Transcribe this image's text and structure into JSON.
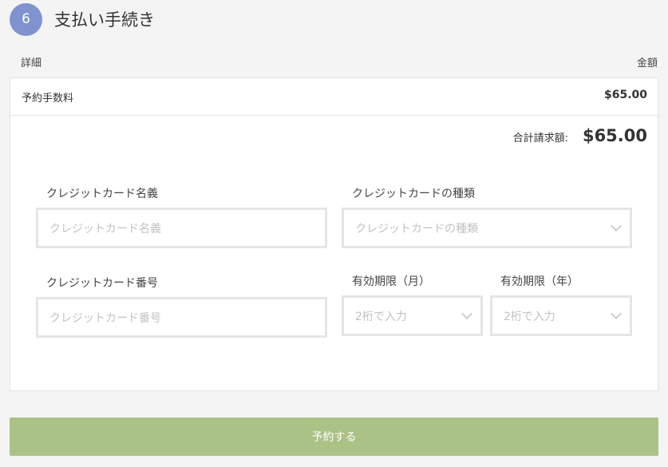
{
  "step": {
    "number": "6",
    "title": "支払い手続き"
  },
  "columns": {
    "left": "詳細",
    "right": "金額"
  },
  "fee": {
    "label": "予約手数料",
    "amount": "$65.00"
  },
  "total": {
    "label": "合計請求額:",
    "amount": "$65.00"
  },
  "form": {
    "card_name": {
      "label": "クレジットカード名義",
      "placeholder": "クレジットカード名義"
    },
    "card_type": {
      "label": "クレジットカードの種類",
      "placeholder": "クレジットカードの種類"
    },
    "card_number": {
      "label": "クレジットカード番号",
      "placeholder": "クレジットカード番号"
    },
    "expiry_month": {
      "label": "有効期限（月）",
      "placeholder": "2桁で入力"
    },
    "expiry_year": {
      "label": "有効期限（年）",
      "placeholder": "2桁で入力"
    }
  },
  "submit_label": "予約する",
  "colors": {
    "step_circle": "#8093cf",
    "submit_button": "#abc286"
  }
}
